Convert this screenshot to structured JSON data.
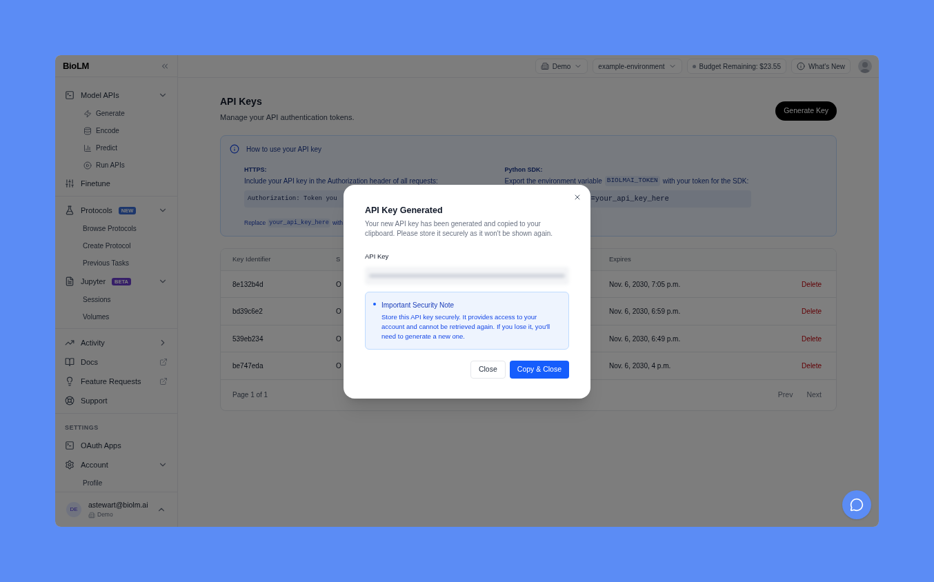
{
  "sidebar": {
    "logo": "BioLM",
    "sections": [
      {
        "items": [
          {
            "kind": "group",
            "label": "Model APIs",
            "expanded": true,
            "children": [
              {
                "kind": "icon",
                "label": "Generate"
              },
              {
                "kind": "icon",
                "label": "Encode"
              },
              {
                "kind": "icon",
                "label": "Predict"
              },
              {
                "kind": "icon",
                "label": "Run APIs"
              }
            ]
          },
          {
            "kind": "link",
            "label": "Finetune"
          }
        ]
      },
      {
        "items": [
          {
            "kind": "group",
            "label": "Protocols",
            "badge": {
              "text": "NEW",
              "kind": "new"
            },
            "expanded": true,
            "children": [
              {
                "kind": "plain",
                "label": "Browse Protocols"
              },
              {
                "kind": "plain",
                "label": "Create Protocol"
              },
              {
                "kind": "plain",
                "label": "Previous Tasks"
              }
            ]
          },
          {
            "kind": "group",
            "label": "Jupyter",
            "badge": {
              "text": "BETA",
              "kind": "beta"
            },
            "expanded": true,
            "children": [
              {
                "kind": "plain",
                "label": "Sessions"
              },
              {
                "kind": "plain",
                "label": "Volumes"
              }
            ]
          }
        ]
      },
      {
        "items": [
          {
            "kind": "group",
            "label": "Activity",
            "expanded": false
          },
          {
            "kind": "external",
            "label": "Docs"
          },
          {
            "kind": "external",
            "label": "Feature Requests"
          },
          {
            "kind": "link",
            "label": "Support"
          }
        ]
      },
      {
        "heading": "SETTINGS",
        "items": [
          {
            "kind": "link",
            "label": "OAuth Apps"
          },
          {
            "kind": "group",
            "label": "Account",
            "expanded": true,
            "children": [
              {
                "kind": "plain",
                "label": "Profile"
              }
            ]
          }
        ]
      }
    ],
    "user": {
      "initials": "DE",
      "email": "astewart@biolm.ai",
      "workspace": "Demo"
    }
  },
  "topbar": {
    "workspace": "Demo",
    "environment": "example-environment",
    "budget": "Budget Remaining: $23.55",
    "whats_new": "What's New"
  },
  "page": {
    "title": "API Keys",
    "subtitle": "Manage your API authentication tokens.",
    "generate_button": "Generate Key"
  },
  "info": {
    "title": "How to use your API key",
    "https": {
      "label": "HTTPS:",
      "description": "Include your API key in the Authorization header of all requests:",
      "code": "Authorization: Token you"
    },
    "python": {
      "label": "Python SDK:",
      "description_before": "Export the environment variable",
      "variable": "BIOLMAI_TOKEN",
      "description_after": "with your token for the SDK:",
      "code": "=your_api_key_here"
    },
    "footnote": {
      "before": "Replace",
      "code": "your_api_key_here",
      "after": "with"
    }
  },
  "table": {
    "columns": [
      "Key Identifier",
      "S",
      "Expires"
    ],
    "rows": [
      {
        "id": "8e132b4d",
        "column_2": "O",
        "expires": "Nov. 6, 2030, 7:05 p.m.",
        "action": "Delete"
      },
      {
        "id": "bd39c6e2",
        "column_2": "O",
        "expires": "Nov. 6, 2030, 6:59 p.m.",
        "action": "Delete"
      },
      {
        "id": "539eb234",
        "column_2": "O",
        "expires": "Nov. 6, 2030, 6:49 p.m.",
        "action": "Delete"
      },
      {
        "id": "be747eda",
        "column_2": "O",
        "expires": "Nov. 6, 2030, 4 p.m.",
        "action": "Delete"
      }
    ],
    "pagination": {
      "label": "Page 1 of 1",
      "prev": {
        "text": "Prev",
        "disabled": true
      },
      "next": {
        "text": "Next",
        "disabled": true
      }
    }
  },
  "modal": {
    "title": "API Key Generated",
    "description": "Your new API key has been generated and copied to your clipboard. Please store it securely as it won't be shown again.",
    "field_label": "API Key",
    "note": {
      "title": "Important Security Note",
      "text": "Store this API key securely. It provides access to your account and cannot be retrieved again. If you lose it, you'll need to generate a new one."
    },
    "buttons": [
      {
        "kind": "secondary",
        "text": "Close"
      },
      {
        "kind": "primary",
        "text": "Copy & Close"
      }
    ]
  }
}
